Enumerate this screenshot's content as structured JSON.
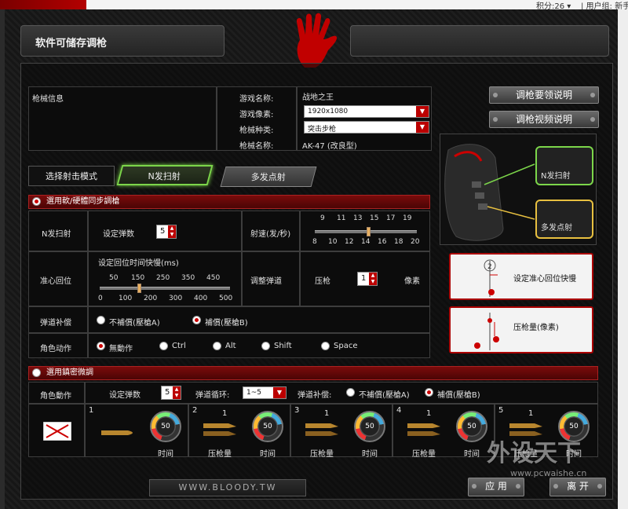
{
  "top_strip": {
    "points": "积分:26 ▾",
    "user": "| 用户组: 新手"
  },
  "window": {
    "title": "软件可储存调枪"
  },
  "gun_info": {
    "panel_label": "枪械信息",
    "game_name_label": "游戏名称:",
    "game_name_value": "战地之王",
    "resolution_label": "游戏像素:",
    "resolution_value": "1920x1080",
    "gun_type_label": "枪械种类:",
    "gun_type_value": "突击步枪",
    "gun_name_label": "枪械名称:",
    "gun_name_value": "AK-47 (改良型)"
  },
  "help_buttons": {
    "recoil_tips": "调枪要领说明",
    "recoil_video": "调枪视频说明"
  },
  "fire_mode": {
    "label": "选择射击模式",
    "tab_burst": "N发扫射",
    "tab_multi": "多发点射"
  },
  "mouse_labels": {
    "burst": "N发扫射",
    "multi": "多发点射"
  },
  "sync_section": {
    "title": "選用軟/硬體同步調槍",
    "burst_label": "N发扫射",
    "set_shots_label": "设定弹数",
    "set_shots_value": "5",
    "rate_label": "射速(发/秒)",
    "rate_ticks_top": [
      "9",
      "11",
      "13",
      "15",
      "17",
      "19"
    ],
    "rate_ticks_bottom": [
      "8",
      "10",
      "12",
      "14",
      "16",
      "18",
      "20"
    ],
    "rate_value": 14.3,
    "recenter_label": "准心回位",
    "recenter_time_label": "设定回位时间快慢(ms)",
    "recenter_ticks_top": [
      "50",
      "150",
      "250",
      "350",
      "450"
    ],
    "recenter_ticks_bottom": [
      "0",
      "100",
      "200",
      "300",
      "400",
      "500"
    ],
    "recenter_value": 150,
    "trajectory_label": "调整弹道",
    "pressure_label": "压枪",
    "pressure_value": "1",
    "pixel_unit": "像素",
    "compensation_label": "弹道补偿",
    "no_comp_label": "不補償(壓槍A)",
    "comp_label": "補償(壓槍B)",
    "char_action_label": "角色动作",
    "actions": [
      "無動作",
      "Ctrl",
      "Alt",
      "Shift",
      "Space"
    ]
  },
  "help_boxes": {
    "recenter": "设定准心回位快慢",
    "pressure": "压枪量(像素)"
  },
  "fine_section": {
    "title": "選用鎮密微調",
    "char_action_label": "角色動作",
    "set_shots_label": "设定弹数",
    "set_shots_value": "5",
    "cycle_label": "弹道循环:",
    "cycle_value": "1~5",
    "comp_label": "弹道补偿:",
    "no_comp_label": "不補償(壓槍A)",
    "comp_on_label": "補償(壓槍B)",
    "slots": [
      {
        "num": "1",
        "gauge": "50",
        "time_label": "时间"
      },
      {
        "num": "2",
        "top": "1",
        "gauge": "50",
        "press_label": "压枪量",
        "time_label": "时间"
      },
      {
        "num": "3",
        "top": "1",
        "gauge": "50",
        "press_label": "压枪量",
        "time_label": "时间"
      },
      {
        "num": "4",
        "top": "1",
        "gauge": "50",
        "press_label": "压枪量",
        "time_label": "时间"
      },
      {
        "num": "5",
        "top": "1",
        "gauge": "50",
        "press_label": "压枪量",
        "time_label": "时间"
      }
    ]
  },
  "footer": {
    "site": "WWW.BLOODY.TW",
    "apply": "应 用",
    "leave": "离 开"
  },
  "watermark": {
    "brand": "外设天下",
    "url": "www.pcwaishe.cn"
  },
  "colors": {
    "accent_red": "#b00000",
    "accent_green": "#7cd64a",
    "accent_yellow": "#e8c040"
  }
}
